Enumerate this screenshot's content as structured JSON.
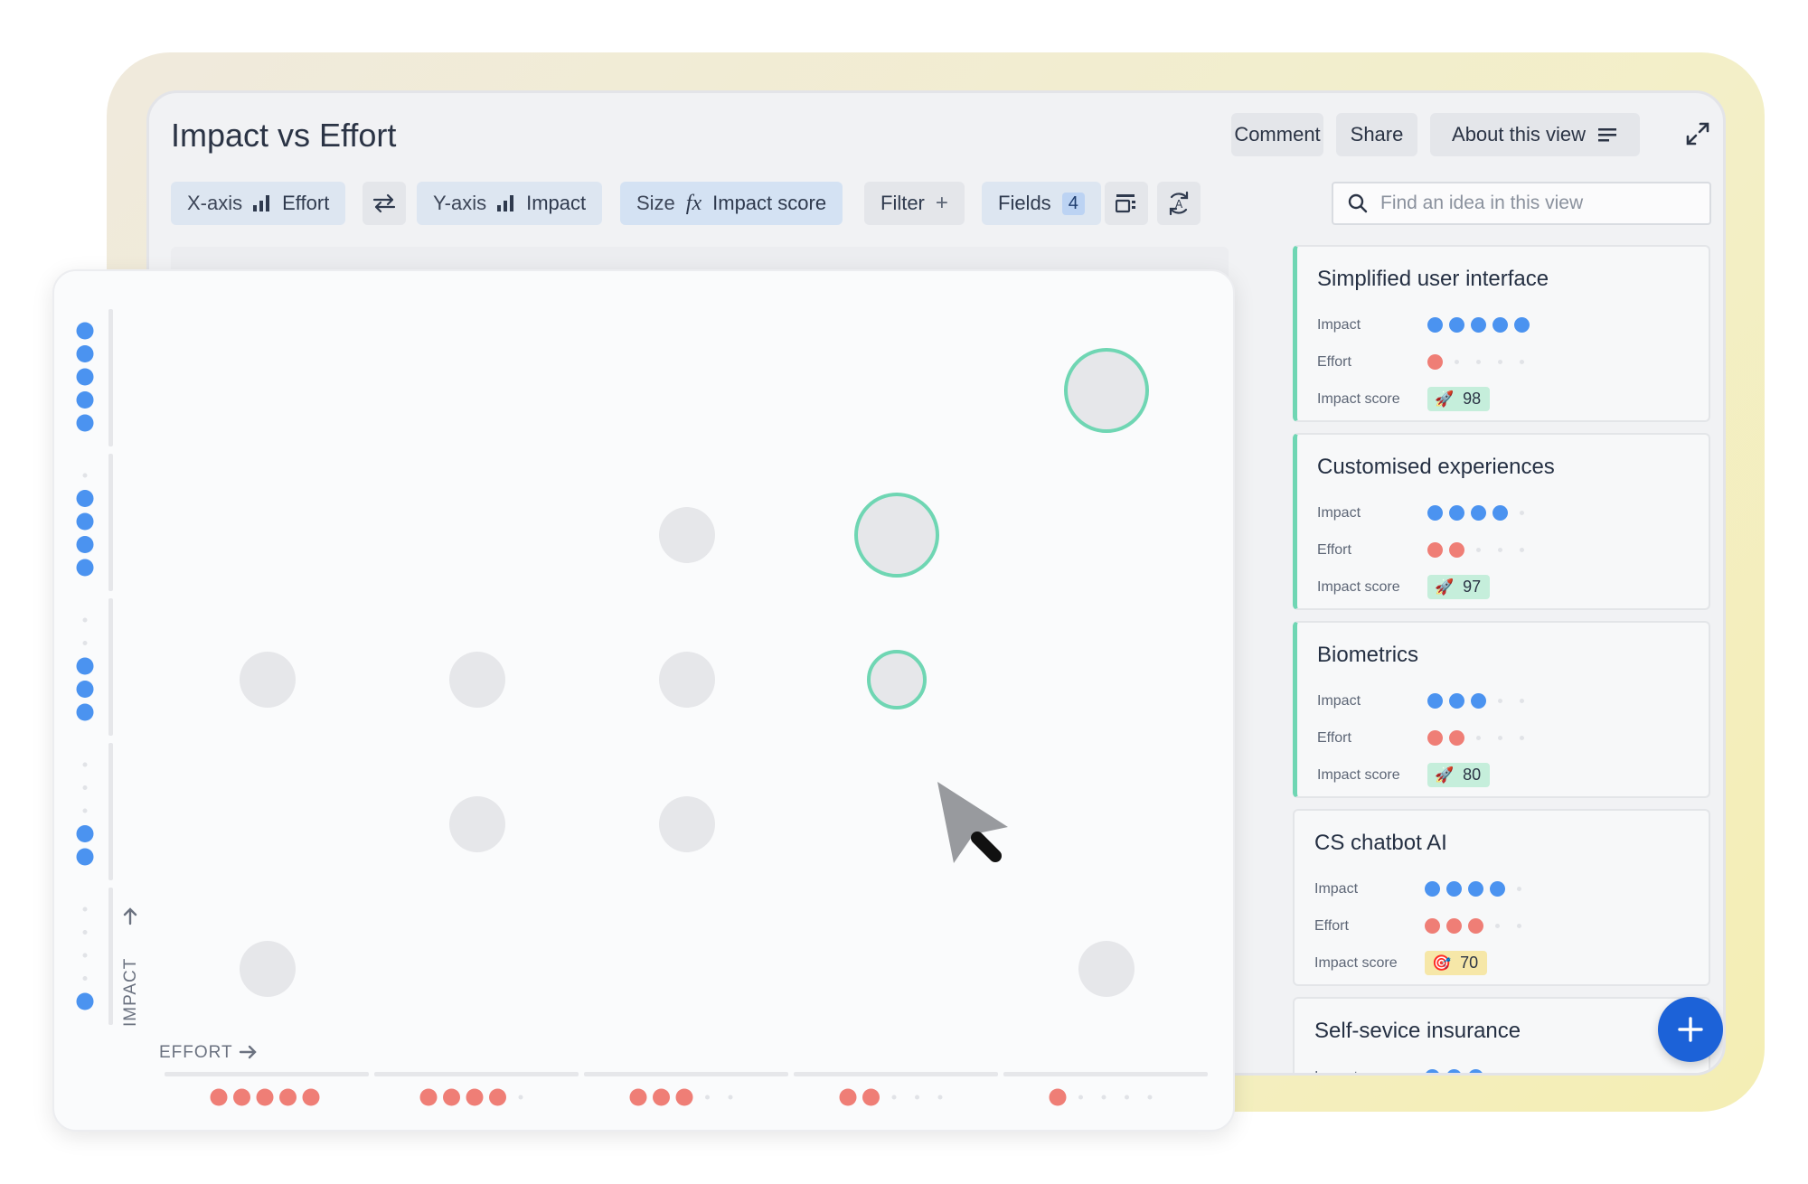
{
  "header": {
    "title": "Impact vs Effort",
    "comment": "Comment",
    "share": "Share",
    "about": "About this view"
  },
  "toolbar": {
    "xaxis_label": "X-axis",
    "xaxis_value": "Effort",
    "yaxis_label": "Y-axis",
    "yaxis_value": "Impact",
    "size_label": "Size",
    "size_fx": "fx",
    "size_value": "Impact score",
    "filter_label": "Filter",
    "fields_label": "Fields",
    "fields_count": "4"
  },
  "search": {
    "placeholder": "Find an idea in this view"
  },
  "cards": [
    {
      "name": "Simplified user interface",
      "impact": 5,
      "effort": 1,
      "score_label": "Impact score",
      "score": "98",
      "score_icon": "rocket-icon",
      "selected": true
    },
    {
      "name": "Customised experiences",
      "impact": 4,
      "effort": 2,
      "score_label": "Impact score",
      "score": "97",
      "score_icon": "rocket-icon",
      "selected": true
    },
    {
      "name": "Biometrics",
      "impact": 3,
      "effort": 2,
      "score_label": "Impact score",
      "score": "80",
      "score_icon": "rocket-icon",
      "selected": true
    },
    {
      "name": "CS chatbot AI",
      "impact": 4,
      "effort": 3,
      "score_label": "Impact score",
      "score": "70",
      "score_icon": "target-icon",
      "selected": false
    },
    {
      "name": "Self-sevice insurance",
      "impact": 3,
      "effort": null,
      "score_label": "",
      "score": "",
      "score_icon": "",
      "selected": false
    }
  ],
  "row_labels": {
    "impact": "Impact",
    "effort": "Effort"
  },
  "colors": {
    "impact": "#4b93f0",
    "effort": "#ef7e76",
    "highlight": "#6fd6b3",
    "bubble": "#e6e7ea",
    "fab": "#1c62d8"
  },
  "chart_data": {
    "type": "scatter",
    "xlabel": "EFFORT",
    "ylabel": "IMPACT",
    "x_levels": [
      5,
      4,
      3,
      2,
      1
    ],
    "y_levels": [
      5,
      4,
      3,
      2,
      1
    ],
    "points": [
      {
        "effort": 1,
        "impact": 5,
        "highlighted": true,
        "size": "large"
      },
      {
        "effort": 2,
        "impact": 4,
        "highlighted": true,
        "size": "large"
      },
      {
        "effort": 3,
        "impact": 4,
        "highlighted": false,
        "size": "medium"
      },
      {
        "effort": 2,
        "impact": 3,
        "highlighted": true,
        "size": "small"
      },
      {
        "effort": 5,
        "impact": 3,
        "highlighted": false,
        "size": "medium"
      },
      {
        "effort": 4,
        "impact": 3,
        "highlighted": false,
        "size": "medium"
      },
      {
        "effort": 3,
        "impact": 3,
        "highlighted": false,
        "size": "medium"
      },
      {
        "effort": 4,
        "impact": 2,
        "highlighted": false,
        "size": "medium"
      },
      {
        "effort": 3,
        "impact": 2,
        "highlighted": false,
        "size": "medium"
      },
      {
        "effort": 5,
        "impact": 1,
        "highlighted": false,
        "size": "medium"
      },
      {
        "effort": 1,
        "impact": 1,
        "highlighted": false,
        "size": "medium"
      }
    ]
  }
}
